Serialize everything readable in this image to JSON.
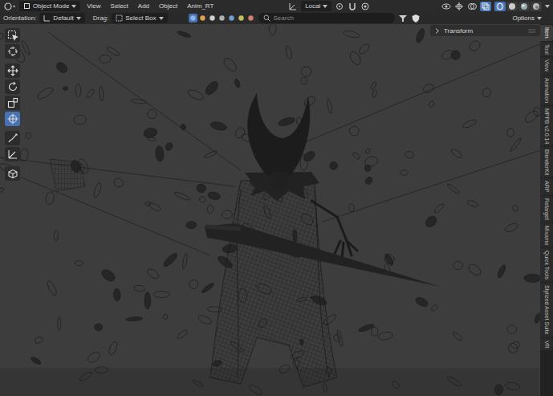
{
  "header": {
    "mode": "Object Mode",
    "menus": [
      "View",
      "Select",
      "Add",
      "Object",
      "Anim_RT"
    ],
    "orientation_dropdown": "Local",
    "xray": {
      "on": true
    },
    "shading": [
      {
        "selected": true
      },
      {
        "selected": false
      },
      {
        "selected": false
      },
      {
        "selected": false
      }
    ]
  },
  "tool_settings": {
    "orientation_label": "Orientation:",
    "orientation": "Default",
    "drag_label": "Drag:",
    "drag": "Select Box",
    "object_filters": [
      {
        "on": true
      },
      {
        "on": false
      },
      {
        "on": false
      },
      {
        "on": false
      },
      {
        "on": false
      },
      {
        "on": false
      },
      {
        "on": false
      }
    ],
    "search": {
      "placeholder": "Search"
    },
    "options": "Options"
  },
  "toolbar": [
    {
      "selected": false
    },
    {
      "selected": false
    },
    {
      "selected": false
    },
    {
      "selected": false
    },
    {
      "selected": false
    },
    {
      "selected": true
    },
    {
      "selected": false
    },
    {
      "selected": false
    },
    {
      "selected": false
    }
  ],
  "sidebar": {
    "panel": {
      "title": "Transform",
      "expanded": false
    },
    "tabs": [
      {
        "label": "Item",
        "selected": true
      },
      {
        "label": "Tool",
        "selected": false
      },
      {
        "label": "View",
        "selected": false
      },
      {
        "label": "Animation",
        "selected": false
      },
      {
        "label": "MPFB v2.0.14",
        "selected": false
      },
      {
        "label": "BlenderKit",
        "selected": false
      },
      {
        "label": "ARP",
        "selected": false
      },
      {
        "label": "Retarget",
        "selected": false
      },
      {
        "label": "Mixamo",
        "selected": false
      },
      {
        "label": "Quick Tools",
        "selected": false
      },
      {
        "label": "Stylized Asset Suite",
        "selected": false
      },
      {
        "label": "VR",
        "selected": false
      }
    ]
  }
}
